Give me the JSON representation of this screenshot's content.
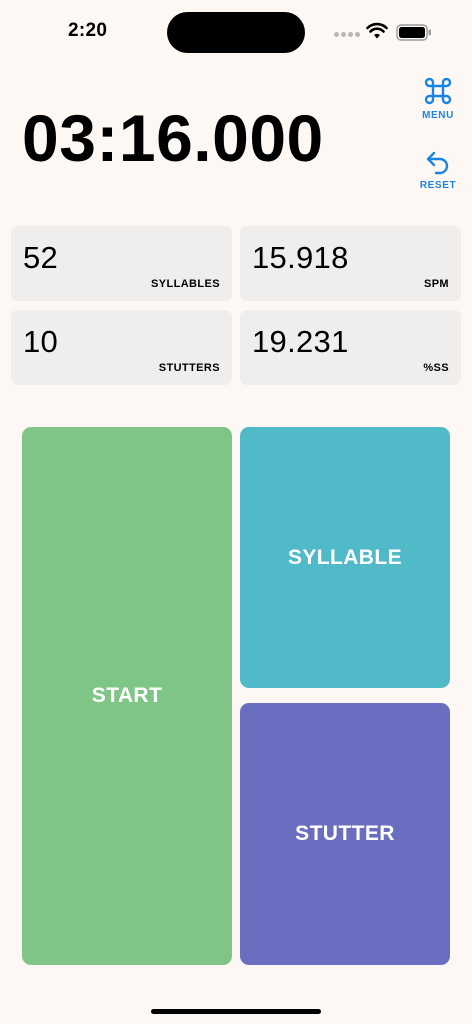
{
  "status_bar": {
    "time": "2:20"
  },
  "timer": {
    "value": "03:16.000"
  },
  "side_actions": {
    "menu_label": "MENU",
    "reset_label": "RESET",
    "accent_color": "#1a84e6"
  },
  "stats": [
    {
      "value": "52",
      "label": "SYLLABLES"
    },
    {
      "value": "15.918",
      "label": "SPM"
    },
    {
      "value": "10",
      "label": "STUTTERS"
    },
    {
      "value": "19.231",
      "label": "%SS"
    }
  ],
  "buttons": {
    "start": {
      "label": "START",
      "color": "#7fc686"
    },
    "syllable": {
      "label": "SYLLABLE",
      "color": "#50bac8"
    },
    "stutter": {
      "label": "STUTTER",
      "color": "#6a6ec0"
    }
  }
}
